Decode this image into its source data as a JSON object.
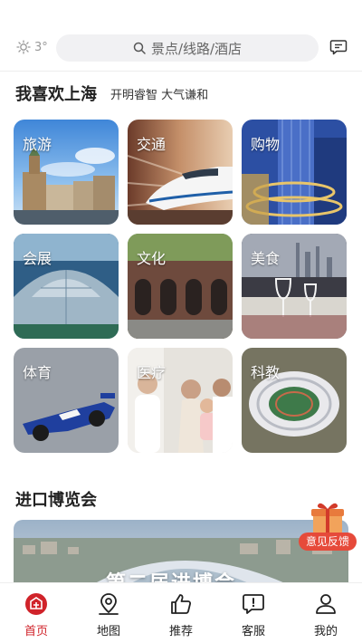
{
  "header": {
    "weather_temp": "3°",
    "search_placeholder": "景点/线路/酒店"
  },
  "section_main": {
    "title": "我喜欢上海",
    "subtitle": "开明睿智 大气谦和"
  },
  "tiles": [
    {
      "label": "旅游",
      "icon": "bund-photo"
    },
    {
      "label": "交通",
      "icon": "train-photo"
    },
    {
      "label": "购物",
      "icon": "mall-photo"
    },
    {
      "label": "会展",
      "icon": "expo-center-photo"
    },
    {
      "label": "文化",
      "icon": "heritage-building-photo"
    },
    {
      "label": "美食",
      "icon": "dining-photo"
    },
    {
      "label": "体育",
      "icon": "race-car-photo"
    },
    {
      "label": "医疗",
      "icon": "family-health-photo"
    },
    {
      "label": "科教",
      "icon": "stadium-photo"
    }
  ],
  "section_expo": {
    "title": "进口博览会",
    "banner_text": "第二届进博会"
  },
  "feedback": {
    "label": "意见反馈"
  },
  "bottom_nav": [
    {
      "label": "首页",
      "icon": "home-icon",
      "active": true
    },
    {
      "label": "地图",
      "icon": "map-pin-icon",
      "active": false
    },
    {
      "label": "推荐",
      "icon": "thumbs-up-icon",
      "active": false
    },
    {
      "label": "客服",
      "icon": "chat-alert-icon",
      "active": false
    },
    {
      "label": "我的",
      "icon": "user-icon",
      "active": false
    }
  ],
  "colors": {
    "accent": "#d0232a",
    "feedback": "#e64a3a"
  }
}
